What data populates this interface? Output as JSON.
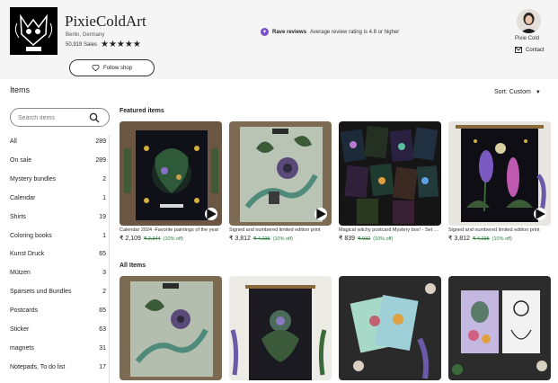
{
  "shop": {
    "name": "PixieColdArt",
    "location": "Berlin, Germany",
    "sales": "50,919 Sales",
    "stars": "★★★★★",
    "follow_label": "Follow shop"
  },
  "rave": {
    "title": "Rave reviews",
    "text": "Average review rating is 4.8 or higher"
  },
  "owner": {
    "name": "Pixie Cold",
    "contact_label": "Contact"
  },
  "items_title": "Items",
  "sort_label": "Sort: Custom",
  "search": {
    "placeholder": "Search items"
  },
  "categories": [
    {
      "name": "All",
      "count": "289"
    },
    {
      "name": "On sale",
      "count": "289"
    },
    {
      "name": "Mystery bundles",
      "count": "2"
    },
    {
      "name": "Calendar",
      "count": "1"
    },
    {
      "name": "Shirts",
      "count": "19"
    },
    {
      "name": "Coloring books",
      "count": "1"
    },
    {
      "name": "Kunst Druck",
      "count": "65"
    },
    {
      "name": "Mützen",
      "count": "3"
    },
    {
      "name": "Sparsets und Bundles",
      "count": "2"
    },
    {
      "name": "Postcards",
      "count": "65"
    },
    {
      "name": "Sticker",
      "count": "63"
    },
    {
      "name": "magnets",
      "count": "31"
    },
    {
      "name": "Notepads, To do list",
      "count": "17"
    }
  ],
  "featured_title": "Featured items",
  "all_items_title": "All Items",
  "featured": [
    {
      "title": "Calendar 2024 -Favorite paintings of the year",
      "price": "₹ 2,109",
      "orig": "₹ 2,344",
      "disc": "(10% off)"
    },
    {
      "title": "Signed and numbered limited edition print",
      "price": "₹ 3,812",
      "orig": "₹ 4,235",
      "disc": "(10% off)"
    },
    {
      "title": "Magical witchy postcard Mystery box! - Set of postcards",
      "price": "₹ 839",
      "orig": "₹ 932",
      "disc": "(10% off)"
    },
    {
      "title": "Signed and numbered limited edition print",
      "price": "₹ 3,812",
      "orig": "₹ 4,235",
      "disc": "(10% off)"
    }
  ],
  "colors": {
    "header_bg": "#f5f5f5",
    "discount_green": "#2a7d3a",
    "rave_purple": "#7b4fc8"
  }
}
